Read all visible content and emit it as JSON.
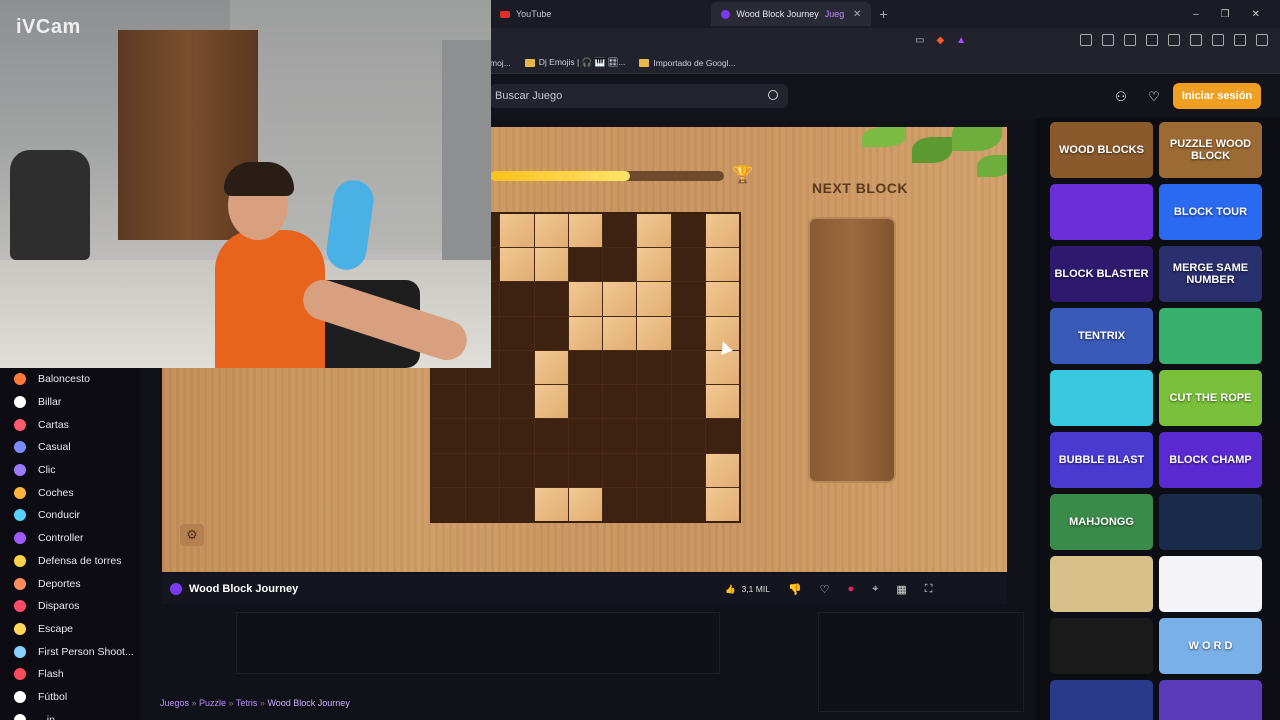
{
  "webcam": {
    "label": "iVCam"
  },
  "browser": {
    "tabs": [
      {
        "label": "YouTube"
      },
      {
        "label": "Wood Block Journey",
        "extra": "Jueg"
      }
    ],
    "bookmarks": [
      {
        "label": "moj..."
      },
      {
        "label": "Dj Emojis | 🎧 🎹 🎛..."
      },
      {
        "label": "Importado de Googl..."
      }
    ]
  },
  "header": {
    "search_placeholder": "Buscar Juego",
    "login_label": "Iniciar sesión"
  },
  "sidebar": {
    "categories": [
      {
        "label": "Baloncesto",
        "color": "#ff7a3c"
      },
      {
        "label": "Billar",
        "color": "#ffffff"
      },
      {
        "label": "Cartas",
        "color": "#ff5a6e"
      },
      {
        "label": "Casual",
        "color": "#7a8cff"
      },
      {
        "label": "Clic",
        "color": "#9a7aff"
      },
      {
        "label": "Coches",
        "color": "#ffb43c"
      },
      {
        "label": "Conducir",
        "color": "#5ad0ff"
      },
      {
        "label": "Controller",
        "color": "#a05aff"
      },
      {
        "label": "Defensa de torres",
        "color": "#ffd24a"
      },
      {
        "label": "Deportes",
        "color": "#ff8c5a"
      },
      {
        "label": "Disparos",
        "color": "#ff4a6a"
      },
      {
        "label": "Escape",
        "color": "#ffd85a"
      },
      {
        "label": "First Person Shoot...",
        "color": "#8ad0ff"
      },
      {
        "label": "Flash",
        "color": "#ff4a5a"
      },
      {
        "label": "Fútbol",
        "color": "#ffffff"
      },
      {
        "label": "...in",
        "color": "#ffffff"
      }
    ]
  },
  "game": {
    "next_block_label": "NEXT BLOCK",
    "progress": 0.6,
    "board": [
      [
        0,
        0,
        1,
        1,
        1,
        0,
        1,
        0,
        1
      ],
      [
        0,
        0,
        1,
        1,
        0,
        0,
        1,
        0,
        1
      ],
      [
        0,
        0,
        0,
        0,
        1,
        1,
        1,
        0,
        1
      ],
      [
        0,
        0,
        0,
        0,
        1,
        1,
        1,
        0,
        1
      ],
      [
        0,
        0,
        0,
        1,
        0,
        0,
        0,
        0,
        1
      ],
      [
        0,
        0,
        0,
        1,
        0,
        0,
        0,
        0,
        1
      ],
      [
        0,
        0,
        0,
        0,
        0,
        0,
        0,
        0,
        0
      ],
      [
        0,
        0,
        0,
        0,
        0,
        0,
        0,
        0,
        1
      ],
      [
        0,
        0,
        0,
        1,
        1,
        0,
        0,
        0,
        1
      ]
    ]
  },
  "gamebar": {
    "title": "Wood Block Journey",
    "likes": "3,1 MIL"
  },
  "breadcrumbs": {
    "items": [
      "Juegos",
      "Puzzle",
      "Tetris"
    ],
    "current": "Wood Block Journey"
  },
  "thumbnails": [
    {
      "label": "WOOD BLOCKS",
      "color": "#8a5a2c"
    },
    {
      "label": "PUZZLE WOOD BLOCK",
      "color": "#9c6a34"
    },
    {
      "label": "",
      "color": "#6a2fd8"
    },
    {
      "label": "BLOCK TOUR",
      "color": "#2a6af0"
    },
    {
      "label": "BLOCK BLASTER",
      "color": "#2d1a6e"
    },
    {
      "label": "MERGE SAME NUMBER",
      "color": "#2a2f6e"
    },
    {
      "label": "TENTRIX",
      "color": "#3a5ab8"
    },
    {
      "label": "",
      "color": "#36b06a"
    },
    {
      "label": "",
      "color": "#3ac8e0"
    },
    {
      "label": "CUT THE ROPE",
      "color": "#7ac03a"
    },
    {
      "label": "BUBBLE BLAST",
      "color": "#4a3ad0"
    },
    {
      "label": "BLOCK CHAMP",
      "color": "#5a2ad0"
    },
    {
      "label": "MAHJONGG",
      "color": "#3a8a4a"
    },
    {
      "label": "",
      "color": "#1a2a4a"
    },
    {
      "label": "",
      "color": "#d8c08a"
    },
    {
      "label": "",
      "color": "#f4f4f8"
    },
    {
      "label": "",
      "color": "#1a1a1a"
    },
    {
      "label": "W O R D",
      "color": "#7ab0e8"
    },
    {
      "label": "",
      "color": "#2a3a8a"
    },
    {
      "label": "",
      "color": "#5a3ab8"
    }
  ]
}
